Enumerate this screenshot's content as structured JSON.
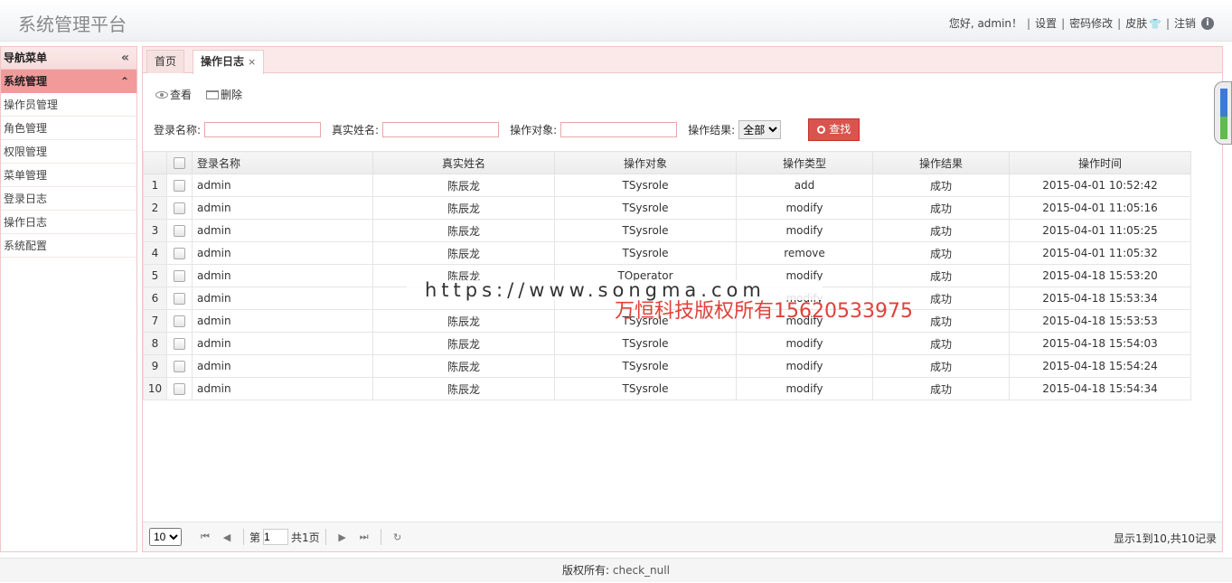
{
  "header": {
    "title": "系统管理平台",
    "greeting": "您好, admin！",
    "settings": "设置",
    "change_password": "密码修改",
    "skin": "皮肤",
    "logout": "注销"
  },
  "sidebar": {
    "title": "导航菜单",
    "group": "系统管理",
    "items": [
      {
        "label": "操作员管理"
      },
      {
        "label": "角色管理"
      },
      {
        "label": "权限管理"
      },
      {
        "label": "菜单管理"
      },
      {
        "label": "登录日志"
      },
      {
        "label": "操作日志"
      },
      {
        "label": "系统配置"
      }
    ]
  },
  "tabs": [
    {
      "label": "首页"
    },
    {
      "label": "操作日志",
      "close": "×"
    }
  ],
  "toolbar": {
    "view": "查看",
    "delete": "删除"
  },
  "search": {
    "login_name_label": "登录名称:",
    "real_name_label": "真实姓名:",
    "object_label": "操作对象:",
    "result_label": "操作结果:",
    "result_value": "全部",
    "button": "查找"
  },
  "grid": {
    "headers": [
      "登录名称",
      "真实姓名",
      "操作对象",
      "操作类型",
      "操作结果",
      "操作时间"
    ],
    "rows": [
      [
        "1",
        "admin",
        "陈辰龙",
        "TSysrole",
        "add",
        "成功",
        "2015-04-01 10:52:42"
      ],
      [
        "2",
        "admin",
        "陈辰龙",
        "TSysrole",
        "modify",
        "成功",
        "2015-04-01 11:05:16"
      ],
      [
        "3",
        "admin",
        "陈辰龙",
        "TSysrole",
        "modify",
        "成功",
        "2015-04-01 11:05:25"
      ],
      [
        "4",
        "admin",
        "陈辰龙",
        "TSysrole",
        "remove",
        "成功",
        "2015-04-01 11:05:32"
      ],
      [
        "5",
        "admin",
        "陈辰龙",
        "TOperator",
        "modify",
        "成功",
        "2015-04-18 15:53:20"
      ],
      [
        "6",
        "admin",
        "",
        "",
        "modify",
        "成功",
        "2015-04-18 15:53:34"
      ],
      [
        "7",
        "admin",
        "陈辰龙",
        "TSysrole",
        "modify",
        "成功",
        "2015-04-18 15:53:53"
      ],
      [
        "8",
        "admin",
        "陈辰龙",
        "TSysrole",
        "modify",
        "成功",
        "2015-04-18 15:54:03"
      ],
      [
        "9",
        "admin",
        "陈辰龙",
        "TSysrole",
        "modify",
        "成功",
        "2015-04-18 15:54:24"
      ],
      [
        "10",
        "admin",
        "陈辰龙",
        "TSysrole",
        "modify",
        "成功",
        "2015-04-18 15:54:34"
      ]
    ]
  },
  "pager": {
    "page_size": "10",
    "page_prefix": "第",
    "page_value": "1",
    "page_total": "共1页",
    "info": "显示1到10,共10记录"
  },
  "footer": {
    "label": "版权所有:",
    "value": "check_null"
  },
  "watermark": {
    "url": "https://www.songma.com",
    "text": "万恒科技版权所有15620533975"
  }
}
